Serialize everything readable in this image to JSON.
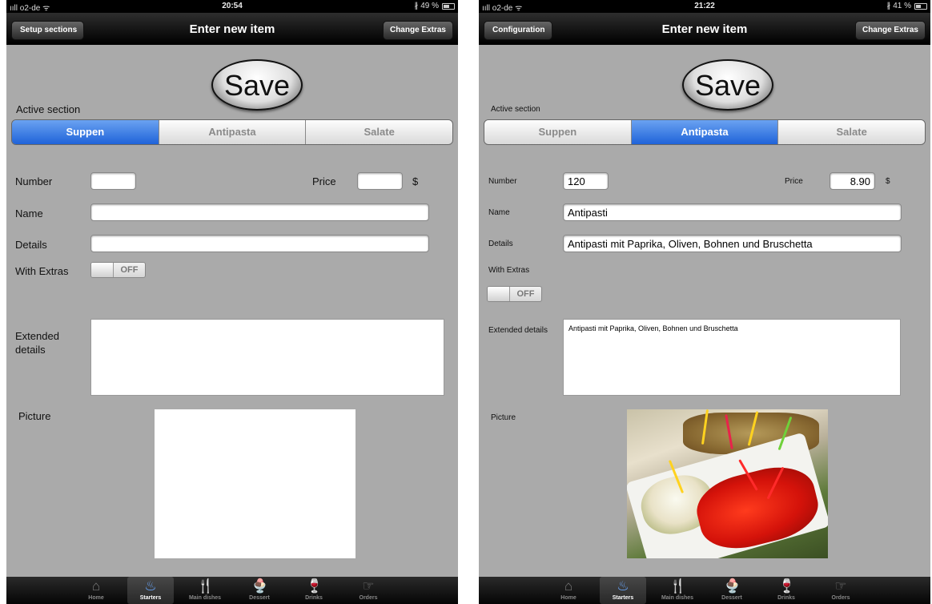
{
  "screen_a": {
    "status": {
      "carrier": "ııll o2-de ᯤ",
      "time": "20:54",
      "battery": "∦ 49 %",
      "battery_level": 0.49
    },
    "nav": {
      "back_label": "Setup sections",
      "title": "Enter new item",
      "right_label": "Change Extras"
    },
    "save_label": "Save",
    "active_section_label": "Active section",
    "segments": [
      {
        "label": "Suppen",
        "active": true
      },
      {
        "label": "Antipasta",
        "active": false
      },
      {
        "label": "Salate",
        "active": false
      }
    ],
    "number_label": "Number",
    "number_value": "",
    "price_label": "Price",
    "price_value": "",
    "currency": "$",
    "name_label": "Name",
    "name_value": "",
    "details_label": "Details",
    "details_value": "",
    "extras_label": "With Extras",
    "extras_state": "OFF",
    "extended_label": "Extended details",
    "extended_value": "",
    "picture_label": "Picture"
  },
  "screen_b": {
    "status": {
      "carrier": "ııll o2-de ᯤ",
      "time": "21:22",
      "battery": "∦ 41 %",
      "battery_level": 0.41
    },
    "nav": {
      "back_label": "Configuration",
      "title": "Enter new item",
      "right_label": "Change Extras"
    },
    "save_label": "Save",
    "active_section_label": "Active section",
    "segments": [
      {
        "label": "Suppen",
        "active": false
      },
      {
        "label": "Antipasta",
        "active": true
      },
      {
        "label": "Salate",
        "active": false
      }
    ],
    "number_label": "Number",
    "number_value": "120",
    "price_label": "Price",
    "price_value": "8.90",
    "currency": "$",
    "name_label": "Name",
    "name_value": "Antipasti",
    "details_label": "Details",
    "details_value": "Antipasti mit Paprika, Oliven, Bohnen und Bruschetta",
    "extras_label": "With Extras",
    "extras_state": "OFF",
    "extended_label": "Extended details",
    "extended_value": "Antipasti mit Paprika, Oliven, Bohnen und Bruschetta",
    "picture_label": "Picture"
  },
  "tabs": [
    {
      "label": "Home",
      "icon": "home-icon",
      "active": false
    },
    {
      "label": "Starters",
      "icon": "starters-icon",
      "active": true
    },
    {
      "label": "Main dishes",
      "icon": "cutlery-icon",
      "active": false
    },
    {
      "label": "Dessert",
      "icon": "dessert-icon",
      "active": false
    },
    {
      "label": "Drinks",
      "icon": "drinks-icon",
      "active": false
    },
    {
      "label": "Orders",
      "icon": "orders-icon",
      "active": false
    }
  ],
  "colors": {
    "segment_active": "#1f63d9",
    "background": "#aaaaaa",
    "bar": "#000000"
  }
}
